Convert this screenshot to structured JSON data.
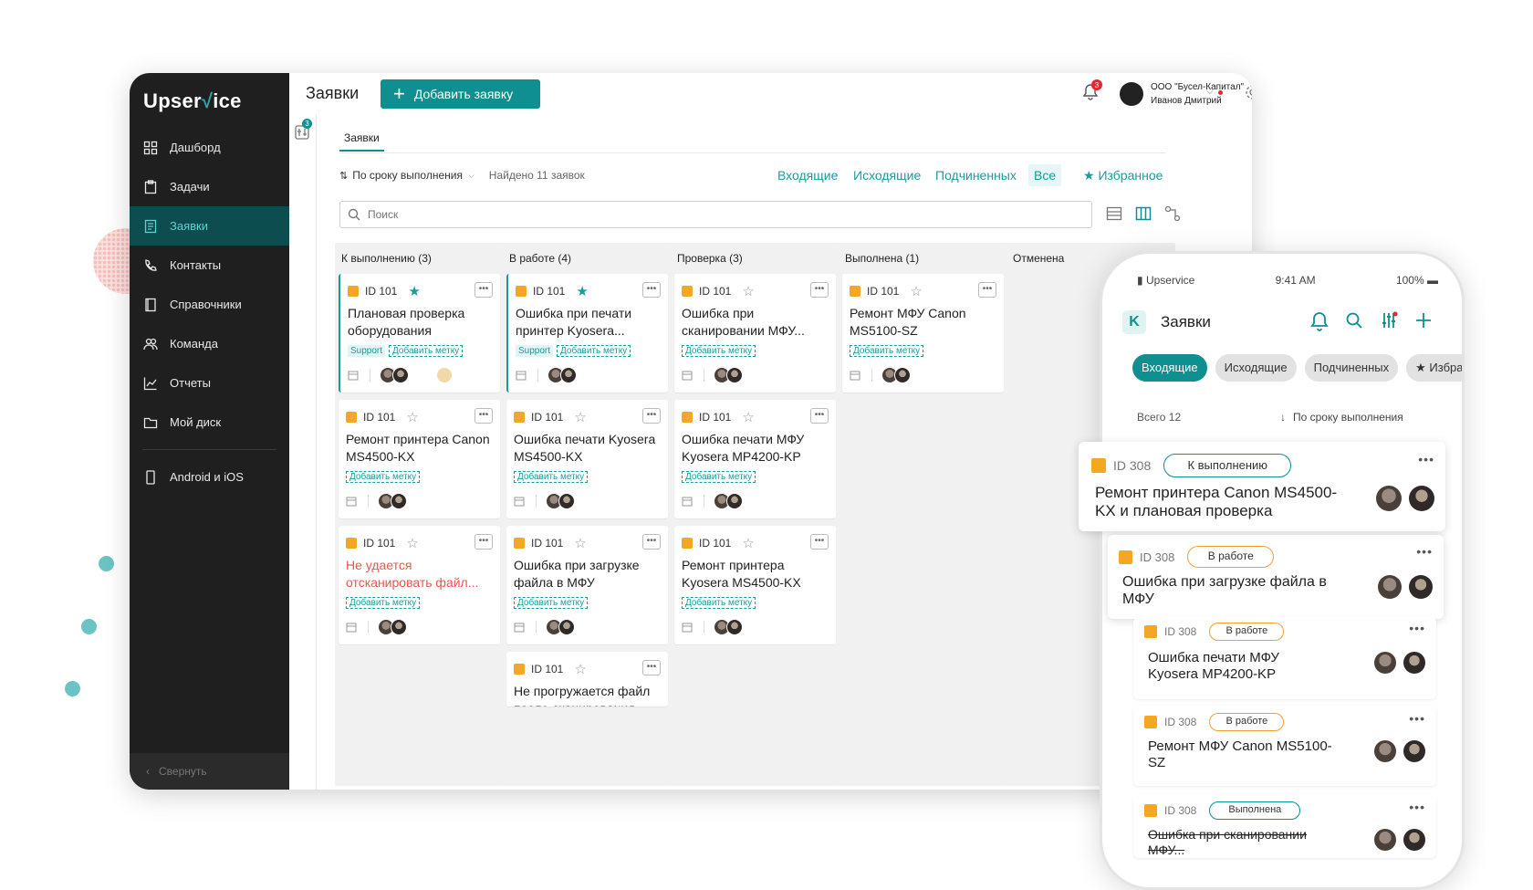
{
  "app": {
    "logo": "Upservice",
    "logo_pre": "Upser",
    "logo_tick": "√",
    "logo_post": "ice",
    "sidebar": {
      "items": [
        {
          "label": "Дашборд",
          "icon": "grid-icon"
        },
        {
          "label": "Задачи",
          "icon": "clipboard-icon"
        },
        {
          "label": "Заявки",
          "icon": "requests-icon",
          "active": true
        },
        {
          "label": "Контакты",
          "icon": "phone-icon"
        },
        {
          "label": "Справочники",
          "icon": "book-icon"
        },
        {
          "label": "Команда",
          "icon": "team-icon"
        },
        {
          "label": "Отчеты",
          "icon": "chart-icon"
        },
        {
          "label": "Мой диск",
          "icon": "folder-icon"
        }
      ],
      "extra": {
        "label": "Android и iOS",
        "icon": "mobile-icon"
      },
      "collapse_label": "Свернуть"
    },
    "topbar": {
      "page_title": "Заявки",
      "add_button": "Добавить заявку",
      "bell_count": "3",
      "org_name": "ООО \"Бусел-Капитал\"",
      "user_name": "Иванов Дмитрий"
    },
    "filter_badge": "3",
    "tab": "Заявки",
    "sort_label": "По сроку  выполнения",
    "found": "Найдено 11 заявок",
    "filters": [
      "Входящие",
      "Исходящие",
      "Подчиненных",
      "Все"
    ],
    "favorites": "Избранное",
    "search_placeholder": "Поиск",
    "columns": [
      {
        "title": "К выполнению (3)",
        "cards": [
          {
            "id": "ID 101",
            "fav": true,
            "title": "Плановая проверка оборудования",
            "labels": [
              "Support",
              "Добавить метку"
            ],
            "accent": true,
            "red": false,
            "emoji": true
          },
          {
            "id": "ID 101",
            "fav": false,
            "title": "Ремонт принтера Canon MS4500-KX",
            "labels": [
              "Добавить метку"
            ],
            "accent": false,
            "red": false
          },
          {
            "id": "ID 101",
            "fav": false,
            "title": "Не удается отсканировать файл...",
            "labels": [
              "Добавить метку"
            ],
            "accent": false,
            "red": true
          }
        ]
      },
      {
        "title": "В работе (4)",
        "cards": [
          {
            "id": "ID 101",
            "fav": true,
            "title": "Ошибка при печати принтер Kyosera...",
            "labels": [
              "Support",
              "Добавить метку"
            ],
            "accent": true,
            "red": false
          },
          {
            "id": "ID 101",
            "fav": false,
            "title": "Ошибка печати Kyosera MS4500-KX",
            "labels": [
              "Добавить метку"
            ],
            "accent": false,
            "red": false
          },
          {
            "id": "ID 101",
            "fav": false,
            "title": "Ошибка при загрузке файла в МФУ",
            "labels": [
              "Добавить метку"
            ],
            "accent": false,
            "red": false
          },
          {
            "id": "ID 101",
            "fav": false,
            "title": "Не прогружается файл после сканирования",
            "labels": [],
            "accent": false,
            "red": false
          }
        ]
      },
      {
        "title": "Проверка (3)",
        "cards": [
          {
            "id": "ID 101",
            "fav": false,
            "title": "Ошибка при сканировании МФУ...",
            "labels": [
              "Добавить метку"
            ],
            "accent": false,
            "red": false
          },
          {
            "id": "ID 101",
            "fav": false,
            "title": "Ошибка печати МФУ Kyosera MP4200-KP",
            "labels": [
              "Добавить метку"
            ],
            "accent": false,
            "red": false
          },
          {
            "id": "ID 101",
            "fav": false,
            "title": "Ремонт принтера Kyosera MS4500-KX",
            "labels": [
              "Добавить метку"
            ],
            "accent": false,
            "red": false
          }
        ]
      },
      {
        "title": "Выполнена (1)",
        "cards": [
          {
            "id": "ID 101",
            "fav": false,
            "title": "Ремонт МФУ Canon MS5100-SZ",
            "labels": [
              "Добавить метку"
            ],
            "accent": false,
            "red": false
          }
        ]
      },
      {
        "title": "Отменена",
        "cards": []
      }
    ]
  },
  "phone": {
    "carrier": "Upservice",
    "time": "9:41 AM",
    "battery": "100%",
    "title": "Заявки",
    "logo": "K",
    "chips": [
      "Входящие",
      "Исходящие",
      "Подчиненных",
      "★ Избранное"
    ],
    "total": "Всего 12",
    "sort": "По сроку выполнения",
    "cards": [
      {
        "id": "ID 308",
        "status": "К выполнению",
        "title": "Ремонт принтера Canon MS4500-KX и плановая проверка"
      },
      {
        "id": "ID 308",
        "status": "В работе",
        "title": "Ошибка при загрузке файла в МФУ"
      },
      {
        "id": "ID 308",
        "status": "В работе",
        "title": "Ошибка печати МФУ Kyosera MP4200-KP"
      },
      {
        "id": "ID 308",
        "status": "В работе",
        "title": "Ремонт МФУ Canon MS5100-SZ"
      },
      {
        "id": "ID 308",
        "status": "Выполнена",
        "title": "Ошибка при сканировании МФУ..."
      }
    ]
  },
  "colors": {
    "accent": "#0f8f8f",
    "sidebar": "#1f1f1f",
    "active": "#0e4d4f",
    "orange": "#f5a623",
    "red": "#e8584b"
  }
}
